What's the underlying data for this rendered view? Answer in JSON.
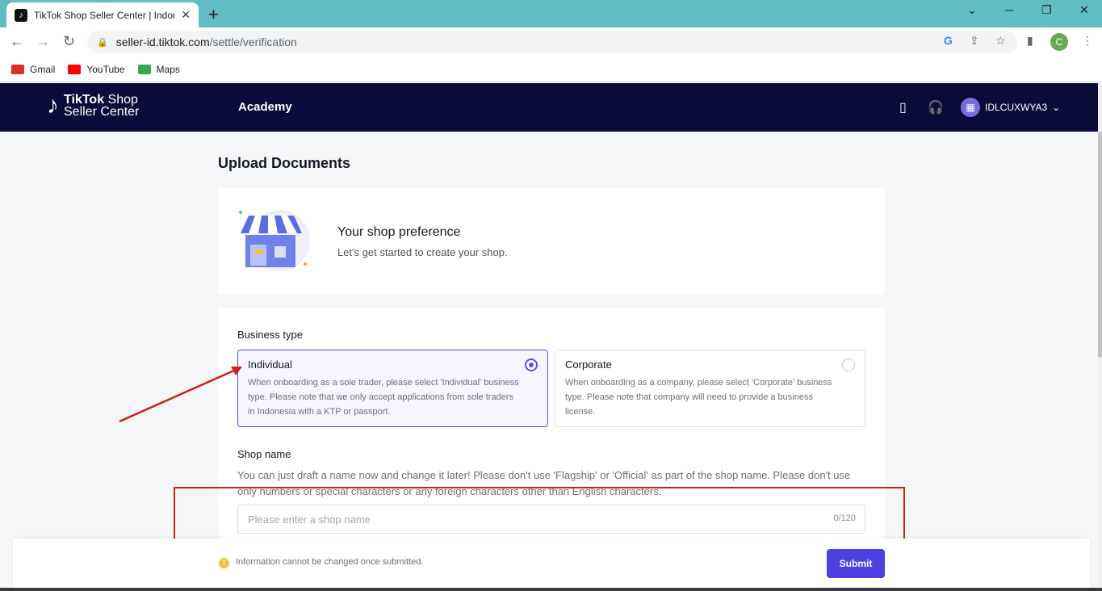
{
  "browser": {
    "tab_title": "TikTok Shop Seller Center | Indonesia",
    "url_host": "seller-id.tiktok.com",
    "url_path": "/settle/verification",
    "profile_initial": "C",
    "bookmarks": [
      {
        "label": "Gmail",
        "color": "#d93025"
      },
      {
        "label": "YouTube",
        "color": "#ff0000"
      },
      {
        "label": "Maps",
        "color": "#34a853"
      }
    ]
  },
  "header": {
    "logo_main": "TikTok",
    "logo_shop": "Shop",
    "logo_sub": "Seller Center",
    "academy": "Academy",
    "username": "IDLCUXWYA3"
  },
  "page": {
    "title": "Upload Documents",
    "preference_title": "Your shop preference",
    "preference_subtitle": "Let's get started to create your shop."
  },
  "form": {
    "business_type_label": "Business type",
    "individual": {
      "title": "Individual",
      "description": "When onboarding as a sole trader, please select 'Individual' business type. Please note that we only accept applications from sole traders in Indonesia with a KTP or passport.",
      "selected": true
    },
    "corporate": {
      "title": "Corporate",
      "description": "When onboarding as a company, please select 'Corporate' business type. Please note that company will need to provide a business license.",
      "selected": false
    },
    "shop_name_label": "Shop name",
    "shop_name_description": "You can just draft a name now and change it later! Please don't use 'Flagship' or 'Official' as part of the shop name. Please don't use only numbers or special characters or any foreign characters other than English characters.",
    "shop_name_value": "",
    "shop_name_placeholder": "Please enter a shop name",
    "shop_name_counter": "0/120"
  },
  "footer": {
    "warning": "Information cannot be changed once submitted.",
    "submit": "Submit"
  },
  "colors": {
    "accent": "#4e3fe0",
    "header_bg": "#0b0b3b",
    "annotation": "#d41a1a"
  }
}
